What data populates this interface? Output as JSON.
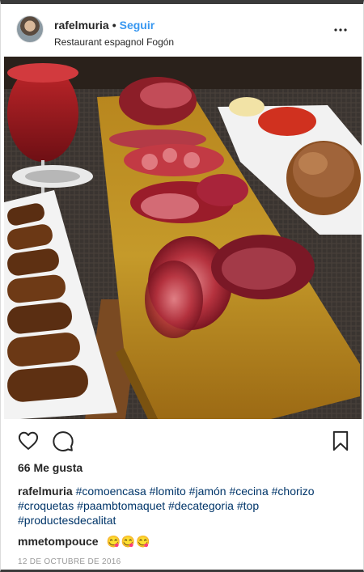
{
  "post": {
    "username": "rafelmuria",
    "separator": "•",
    "follow_label": "Seguir",
    "location": "Restaurant espagnol Fogón",
    "likes": "66 Me gusta",
    "caption_user": "rafelmuria",
    "caption_text": "#comoencasa #lomito #jamón #cecina #chorizo #croquetas #paambtomaquet #decategoria #top #productesdecalitat",
    "comment_user": "mmetompouce",
    "comment_text": "😋😋😋",
    "date": "12 DE OCTUBRE DE 2016"
  },
  "icons": {
    "more": "more-options-icon",
    "like": "heart-icon",
    "comment": "comment-bubble-icon",
    "save": "bookmark-icon"
  },
  "colors": {
    "link": "#3897f0",
    "hashtag": "#003569",
    "text": "#262626",
    "muted": "#999999"
  }
}
